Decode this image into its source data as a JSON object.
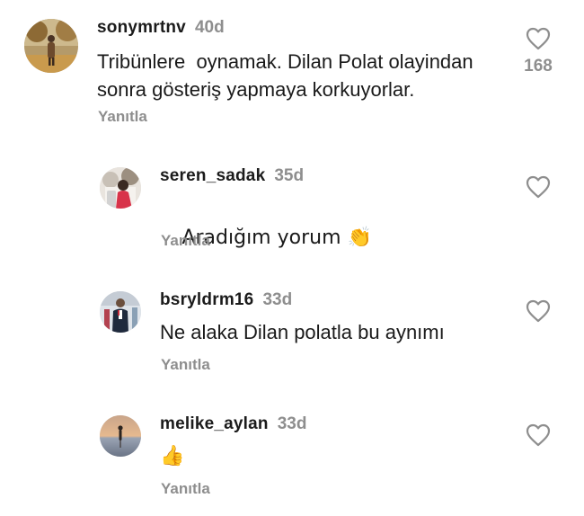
{
  "comments": [
    {
      "username": "sonymrtnv",
      "time": "40d",
      "text": "Tribünlere  oynamak. Dilan Polat olayindan\nsonra gösteriş yapmaya korkuyorlar.",
      "reply_label": "Yanıtla",
      "like_count": "168"
    },
    {
      "username": "seren_sadak",
      "time": "35d",
      "text": "Aradığım yorum 👏",
      "reply_label": "Yanıtla"
    },
    {
      "username": "bsryldrm16",
      "time": "33d",
      "text": "Ne alaka Dilan polatla bu aynımı",
      "reply_label": "Yanıtla"
    },
    {
      "username": "melike_aylan",
      "time": "33d",
      "text": "👍",
      "reply_label": "Yanıtla"
    }
  ],
  "icons": {
    "like": "heart-outline-icon"
  },
  "colors": {
    "secondary_text": "#8e8e8e",
    "primary_text": "#1a1a1a"
  }
}
